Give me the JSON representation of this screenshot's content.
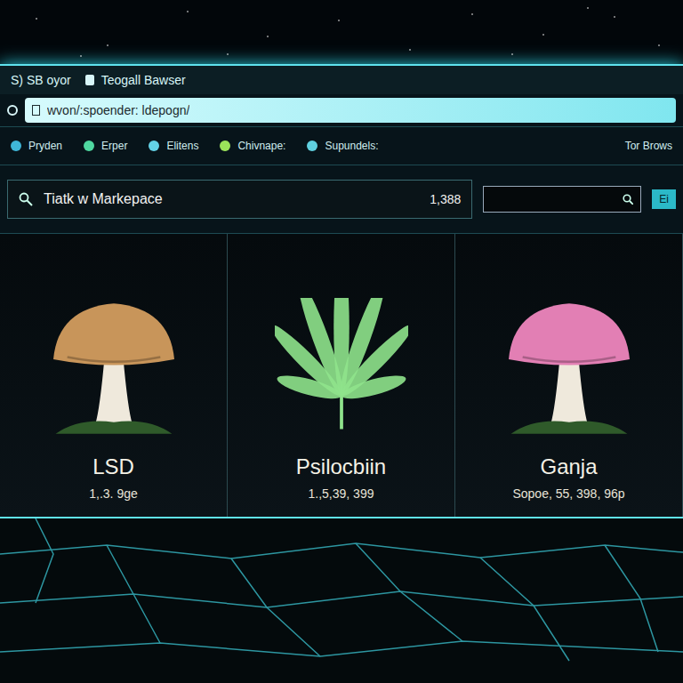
{
  "window": {
    "title_left": "S) SB oyor",
    "title": "Teogall Bawser",
    "brand": "Tor Brows"
  },
  "address_bar": {
    "url": "wvon/:spoender: ldepogn/"
  },
  "bookmarks": [
    {
      "label": "Pryden"
    },
    {
      "label": "Erper"
    },
    {
      "label": "Elitens"
    },
    {
      "label": "Chivnape:"
    },
    {
      "label": "Supundels:"
    }
  ],
  "marketplace": {
    "title": "Tiatk w Markepace",
    "count": "1,388",
    "button": "Ei"
  },
  "products": [
    {
      "name": "LSD",
      "price": "1,.3. 9ge",
      "kind": "mushroom",
      "color": "#c8955a"
    },
    {
      "name": "Psilocbiin",
      "price": "1.,5,39, 399",
      "kind": "leaf",
      "color": "#8fe38c"
    },
    {
      "name": "Ganja",
      "price": "Sopoe, 55, 398, 96p",
      "kind": "mushroom",
      "color": "#e27fb4"
    }
  ]
}
